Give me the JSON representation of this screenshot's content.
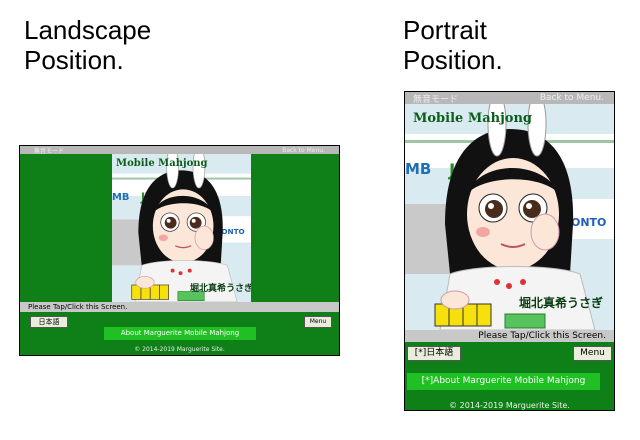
{
  "headings": {
    "landscape": [
      "Landscape",
      "Position."
    ],
    "portrait": [
      "Portrait",
      "Position."
    ]
  },
  "screen": {
    "top_left": "無音モード",
    "top_right": "Back to Menu.",
    "art_title": "Mobile Mahjong",
    "art_name": "堀北真希うさぎ",
    "tap_prompt": "Please Tap/Click this Screen.",
    "landscape": {
      "lang_button": "日本語",
      "menu_button": "Menu",
      "about": "About Marguerite Mobile Mahjong"
    },
    "portrait": {
      "lang_button": "[*]日本語",
      "menu_button": "Menu",
      "about": "[*]About Marguerite Mobile Mahjong"
    },
    "copyright": "© 2014-2019 Marguerite Site."
  },
  "colors": {
    "screen_green": "#0f7f17",
    "about_green": "#20bf23",
    "bar_gray": "#b8b8b8"
  }
}
